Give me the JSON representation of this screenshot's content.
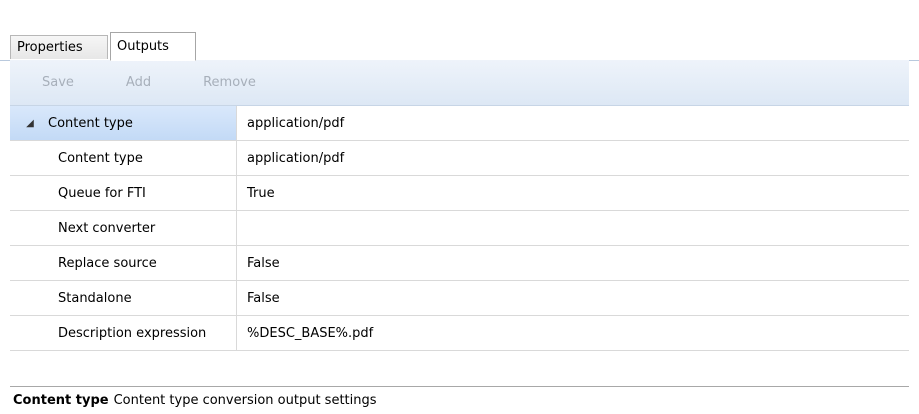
{
  "tabs": [
    {
      "label": "Properties"
    },
    {
      "label": "Outputs"
    }
  ],
  "toolbar": {
    "save_label": "Save",
    "add_label": "Add",
    "remove_label": "Remove"
  },
  "grid": {
    "group_label": "Content type",
    "group_value": "application/pdf",
    "rows": [
      {
        "label": "Content type",
        "value": "application/pdf"
      },
      {
        "label": "Queue for FTI",
        "value": "True"
      },
      {
        "label": "Next converter",
        "value": ""
      },
      {
        "label": "Replace source",
        "value": "False"
      },
      {
        "label": "Standalone",
        "value": "False"
      },
      {
        "label": "Description expression",
        "value": "%DESC_BASE%.pdf"
      }
    ]
  },
  "status": {
    "title": "Content type",
    "description": "Content type conversion output settings"
  },
  "icons": {
    "expander": "expander-arrow-icon"
  },
  "colors": {
    "selected_row": "#c3daf6",
    "toolbar_bg": "#dde8f5",
    "disabled_text": "#a7afba"
  }
}
